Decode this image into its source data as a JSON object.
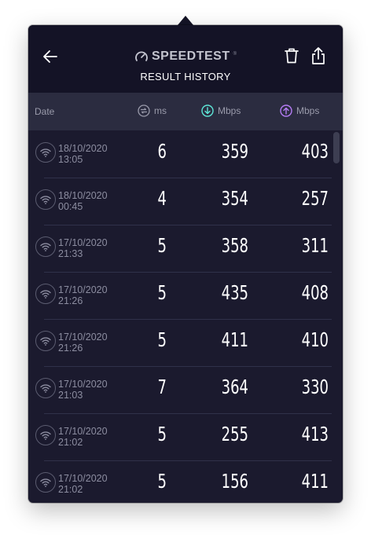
{
  "header": {
    "brand": "SPEEDTEST",
    "brand_tm": "®",
    "subtitle": "RESULT HISTORY"
  },
  "columns": {
    "date": "Date",
    "ping": "ms",
    "download": "Mbps",
    "upload": "Mbps"
  },
  "colors": {
    "ping_icon": "#9a9bab",
    "download_icon": "#5ee6d7",
    "upload_icon": "#b57cf5"
  },
  "results": [
    {
      "date": "18/10/2020",
      "time": "13:05",
      "ping": "6",
      "download": "359",
      "upload": "403"
    },
    {
      "date": "18/10/2020",
      "time": "00:45",
      "ping": "4",
      "download": "354",
      "upload": "257"
    },
    {
      "date": "17/10/2020",
      "time": "21:33",
      "ping": "5",
      "download": "358",
      "upload": "311"
    },
    {
      "date": "17/10/2020",
      "time": "21:26",
      "ping": "5",
      "download": "435",
      "upload": "408"
    },
    {
      "date": "17/10/2020",
      "time": "21:26",
      "ping": "5",
      "download": "411",
      "upload": "410"
    },
    {
      "date": "17/10/2020",
      "time": "21:03",
      "ping": "7",
      "download": "364",
      "upload": "330"
    },
    {
      "date": "17/10/2020",
      "time": "21:02",
      "ping": "5",
      "download": "255",
      "upload": "413"
    },
    {
      "date": "17/10/2020",
      "time": "21:02",
      "ping": "5",
      "download": "156",
      "upload": "411"
    }
  ]
}
